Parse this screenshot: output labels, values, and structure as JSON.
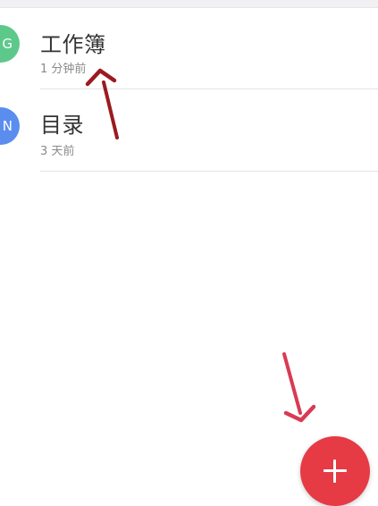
{
  "colors": {
    "background": "#ffffff",
    "avatar_green": "#5cc98a",
    "avatar_blue": "#5b8def",
    "fab_red": "#e63a45",
    "arrow_dark_red": "#9b1b1f",
    "arrow_pink_red": "#d93a53"
  },
  "list": {
    "items": [
      {
        "avatar_letter": "G",
        "title": "工作簿",
        "subtitle": "1 分钟前"
      },
      {
        "avatar_letter": "N",
        "title": "目录",
        "subtitle": "3 天前"
      }
    ]
  },
  "fab": {
    "icon": "plus-icon"
  },
  "annotations": {
    "arrow_1_icon": "arrow-icon",
    "arrow_2_icon": "arrow-icon"
  }
}
